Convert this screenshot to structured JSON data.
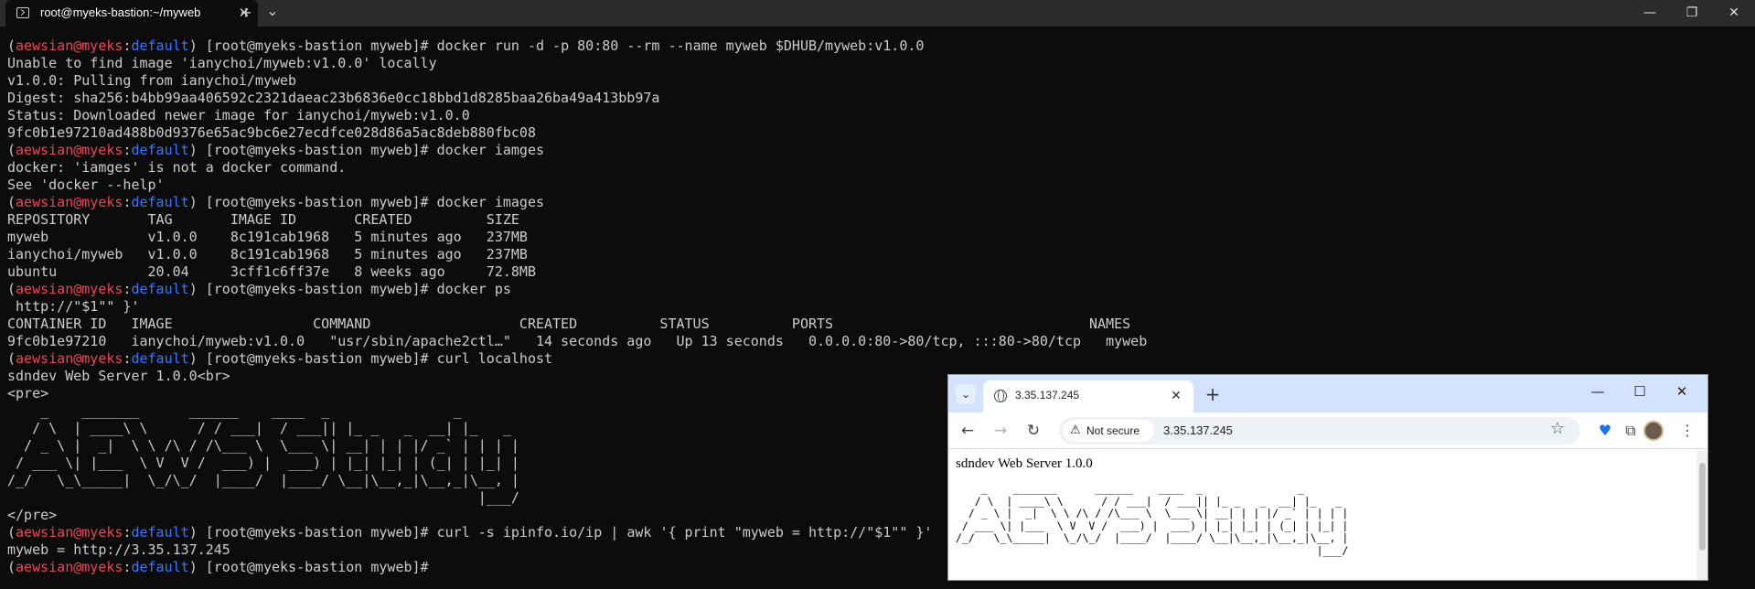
{
  "terminal": {
    "tab_title": "root@myeks-bastion:~/myweb",
    "tab_close_glyph": "✕",
    "new_tab_glyph": "+",
    "dropdown_glyph": "⌄",
    "win_minimize": "—",
    "win_maximize": "❐",
    "win_close": "✕",
    "lines": [
      {
        "user": "aewsian@myeks",
        "ctx": "default",
        "rest": ") [root@myeks-bastion myweb]# docker run -d -p 80:80 --rm --name myweb $DHUB/myweb:v1.0.0"
      },
      {
        "text": "Unable to find image 'ianychoi/myweb:v1.0.0' locally"
      },
      {
        "text": "v1.0.0: Pulling from ianychoi/myweb"
      },
      {
        "text": "Digest: sha256:b4bb99aa406592c2321daeac23b6836e0cc18bbd1d8285baa26ba49a413bb97a"
      },
      {
        "text": "Status: Downloaded newer image for ianychoi/myweb:v1.0.0"
      },
      {
        "text": "9fc0b1e97210ad488b0d9376e65ac9bc6e27ecdfce028d86a5ac8deb880fbc08"
      },
      {
        "user": "aewsian@myeks",
        "ctx": "default",
        "rest": ") [root@myeks-bastion myweb]# docker iamges"
      },
      {
        "text": "docker: 'iamges' is not a docker command."
      },
      {
        "text": "See 'docker --help'"
      },
      {
        "user": "aewsian@myeks",
        "ctx": "default",
        "rest": ") [root@myeks-bastion myweb]# docker images"
      },
      {
        "text": "REPOSITORY       TAG       IMAGE ID       CREATED         SIZE"
      },
      {
        "text": "myweb            v1.0.0    8c191cab1968   5 minutes ago   237MB"
      },
      {
        "text": "ianychoi/myweb   v1.0.0    8c191cab1968   5 minutes ago   237MB"
      },
      {
        "text": "ubuntu           20.04     3cff1c6ff37e   8 weeks ago     72.8MB"
      },
      {
        "user": "aewsian@myeks",
        "ctx": "default",
        "rest": ") [root@myeks-bastion myweb]# docker ps"
      },
      {
        "text": " http://\"$1\"\" }'"
      },
      {
        "text": "CONTAINER ID   IMAGE                 COMMAND                  CREATED          STATUS          PORTS                               NAMES"
      },
      {
        "text": "9fc0b1e97210   ianychoi/myweb:v1.0.0   \"usr/sbin/apache2ctl…\"   14 seconds ago   Up 13 seconds   0.0.0.0:80->80/tcp, :::80->80/tcp   myweb"
      },
      {
        "user": "aewsian@myeks",
        "ctx": "default",
        "rest": ") [root@myeks-bastion myweb]# curl localhost"
      },
      {
        "text": "sdndev Web Server 1.0.0<br>"
      },
      {
        "text": "<pre>"
      },
      {
        "text": "    _    _______      ______    ____  _               _"
      },
      {
        "text": "   / \\  | ____\\ \\      / / ___|  / ___|| |_ _   _  __| |_   _"
      },
      {
        "text": "  / _ \\ |  _|  \\ \\ /\\ / /\\___ \\  \\___ \\| __| | | |/ _` | | | |"
      },
      {
        "text": " / ___ \\| |___  \\ V  V /  ___) |  ___) | |_| |_| | (_| | |_| |"
      },
      {
        "text": "/_/   \\_\\_____|  \\_/\\_/  |____/  |____/ \\__|\\__,_|\\__,_|\\__, |"
      },
      {
        "text": "                                                         |___/"
      },
      {
        "text": "</pre>"
      },
      {
        "user": "aewsian@myeks",
        "ctx": "default",
        "rest": ") [root@myeks-bastion myweb]# curl -s ipinfo.io/ip | awk '{ print \"myweb = http://\"$1\"\" }'"
      },
      {
        "text": "myweb = http://3.35.137.245"
      },
      {
        "user": "aewsian@myeks",
        "ctx": "default",
        "rest": ") [root@myeks-bastion myweb]# "
      }
    ]
  },
  "browser": {
    "tab_title": "3.35.137.245",
    "tab_close_glyph": "✕",
    "new_tab_glyph": "+",
    "dropdown_glyph": "⌄",
    "win_minimize": "—",
    "win_maximize": "☐",
    "win_close": "✕",
    "back_glyph": "←",
    "forward_glyph": "→",
    "reload_glyph": "↻",
    "not_secure_icon": "⚠",
    "not_secure_label": "Not secure",
    "url": "3.35.137.245",
    "star_glyph": "☆",
    "heart_glyph": "♥",
    "extensions_glyph": "⧉",
    "menu_glyph": "⋮",
    "page": {
      "heading": "sdndev Web Server 1.0.0",
      "art_lines": [
        "    _    _______      ______    ____  _               _",
        "   / \\  | ____\\ \\      / / ___|  / ___|| |_ _   _  __| |_   _",
        "  / _ \\ |  _|  \\ \\ /\\ / /\\___ \\  \\___ \\| __| | | |/ _` | | | |",
        " / ___ \\| |___  \\ V  V /  ___) |  ___) | |_| |_| | (_| | |_| |",
        "/_/   \\_\\_____|  \\_/\\_/  |____/  |____/ \\__|\\__,_|\\__,_|\\__, |",
        "                                                         |___/"
      ]
    }
  },
  "colors": {
    "terminal_bg": "#0c0c0c",
    "terminal_fg": "#cccccc",
    "prompt_user": "#e74856",
    "prompt_ctx": "#3b78ff",
    "browser_tabbar": "#d3e3fd"
  }
}
